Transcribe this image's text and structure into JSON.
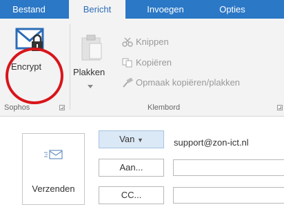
{
  "tabs": [
    {
      "label": "Bestand",
      "active": false
    },
    {
      "label": "Bericht",
      "active": true
    },
    {
      "label": "Invoegen",
      "active": false
    },
    {
      "label": "Opties",
      "active": false
    }
  ],
  "ribbon": {
    "encrypt_label": "Encrypt",
    "paste_label": "Plakken",
    "clipboard_items": [
      {
        "label": "Knippen",
        "icon": "scissors-icon"
      },
      {
        "label": "Kopiëren",
        "icon": "copy-icon"
      },
      {
        "label": "Opmaak kopiëren/plakken",
        "icon": "format-painter-icon"
      }
    ],
    "groups": {
      "sophos": "Sophos",
      "clipboard": "Klembord"
    }
  },
  "compose": {
    "send_label": "Verzenden",
    "from_label": "Van",
    "from_value": "support@zon-ict.nl",
    "to_label": "Aan...",
    "cc_label": "CC..."
  },
  "colors": {
    "tabbar": "#2b78c6",
    "highlight_ring": "#d8151b",
    "ribbon_bg": "#f3f3f3"
  }
}
